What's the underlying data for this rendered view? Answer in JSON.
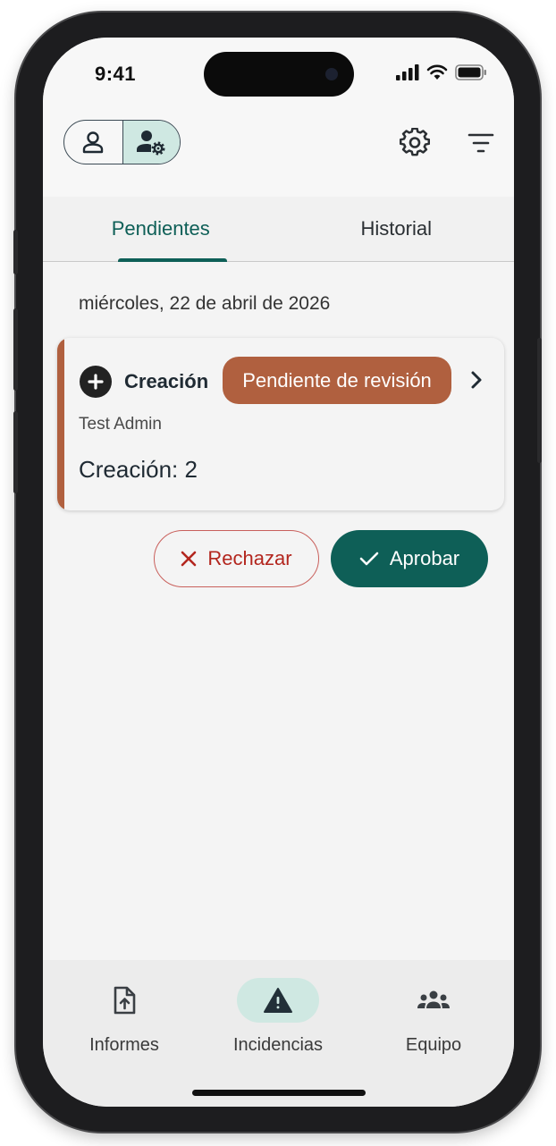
{
  "status_bar": {
    "time": "9:41"
  },
  "app_bar": {
    "role_toggle": {
      "options": [
        "user-icon",
        "user-settings-icon"
      ],
      "selected": 1
    },
    "actions": [
      "settings-icon",
      "filter-icon"
    ]
  },
  "tabs": [
    {
      "label": "Pendientes",
      "active": true
    },
    {
      "label": "Historial",
      "active": false
    }
  ],
  "date_header": "miércoles, 22 de abril de 2026",
  "card": {
    "type_icon": "plus-circle-icon",
    "type_label": "Creación",
    "status": "Pendiente de revisión",
    "author": "Test Admin",
    "summary": "Creación: 2",
    "accent_color": "#b0603f"
  },
  "actions": {
    "reject_label": "Rechazar",
    "approve_label": "Aprobar"
  },
  "bottom_nav": [
    {
      "label": "Informes",
      "icon": "report-upload-icon",
      "active": false
    },
    {
      "label": "Incidencias",
      "icon": "warning-triangle-icon",
      "active": true
    },
    {
      "label": "Equipo",
      "icon": "team-icon",
      "active": false
    }
  ],
  "colors": {
    "primary": "#0e5f57",
    "badge": "#b0603f",
    "reject": "#b3261e",
    "selected_tint": "#cfe8e2"
  }
}
